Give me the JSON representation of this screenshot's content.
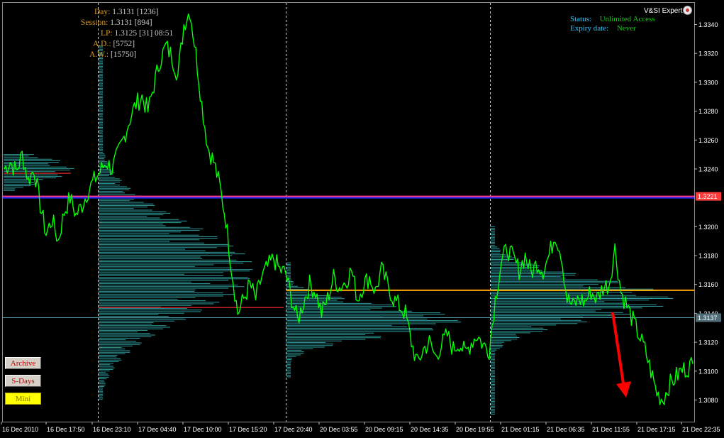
{
  "info": {
    "day_label": "Day:",
    "day_value": "1.3131  [1236]",
    "session_label": "Session:",
    "session_value": "1.3131  [894]",
    "lp_label": "LP:",
    "lp_value": "1.3125  [31]  08:51",
    "ad_label": "A.D.:",
    "ad_value": "[5752]",
    "aw_label": "A.W.:",
    "aw_value": "[15750]"
  },
  "status": {
    "status_label": "Status:",
    "status_value": "Unlimited Access",
    "expiry_label": "Expiry date:",
    "expiry_value": "Never"
  },
  "expert": {
    "name": "V&SI Expert"
  },
  "buttons": {
    "archive": "Archive",
    "sdays": "S-Days",
    "mini": "Mini"
  },
  "colors": {
    "price": "#00ff00",
    "profile": "#2e9b9b",
    "session_line": "#ffa500",
    "price_line": "#ff3a8a",
    "blue_line": "#1e2aff",
    "arrow": "#ff0000",
    "label_price_bg": "#ff3a3a",
    "label_cyan_bg": "#506e78"
  },
  "chart_data": {
    "type": "line",
    "y_ticks": [
      "1.3340",
      "1.3320",
      "1.3300",
      "1.3280",
      "1.3260",
      "1.3240",
      "1.3200",
      "1.3180",
      "1.3160",
      "1.3140",
      "1.3120",
      "1.3100",
      "1.3080"
    ],
    "ylim": [
      1.3065,
      1.3355
    ],
    "x_ticks": [
      "16 Dec 2010",
      "16 Dec 17:50",
      "16 Dec 23:10",
      "17 Dec 04:40",
      "17 Dec 10:00",
      "17 Dec 15:20",
      "17 Dec 20:40",
      "20 Dec 03:55",
      "20 Dec 09:15",
      "20 Dec 14:35",
      "20 Dec 19:55",
      "21 Dec 01:15",
      "21 Dec 06:35",
      "21 Dec 11:55",
      "21 Dec 17:15",
      "21 Dec 22:35"
    ],
    "series": [
      {
        "values": [
          1.324,
          1.3245,
          1.3238,
          1.325,
          1.3232,
          1.324,
          1.3215,
          1.3195,
          1.3205,
          1.319,
          1.321,
          1.322,
          1.3208,
          1.3215,
          1.3225,
          1.3232,
          1.3238,
          1.3245,
          1.324,
          1.325,
          1.3262,
          1.3275,
          1.3285,
          1.329,
          1.328,
          1.3298,
          1.3315,
          1.3325,
          1.3318,
          1.3305,
          1.334,
          1.335,
          1.332,
          1.3285,
          1.3255,
          1.3245,
          1.3228,
          1.3205,
          1.317,
          1.314,
          1.315,
          1.316,
          1.315,
          1.3165,
          1.3172,
          1.3178,
          1.317,
          1.3168,
          1.315,
          1.3135,
          1.3148,
          1.316,
          1.3155,
          1.314,
          1.315,
          1.3165,
          1.3158,
          1.3162,
          1.317,
          1.315,
          1.316,
          1.3165,
          1.3155,
          1.317,
          1.316,
          1.315,
          1.3145,
          1.314,
          1.312,
          1.3105,
          1.3115,
          1.312,
          1.311,
          1.3118,
          1.3125,
          1.3115,
          1.312,
          1.3112,
          1.312,
          1.3125,
          1.3118,
          1.3115,
          1.315,
          1.3175,
          1.3185,
          1.3178,
          1.317,
          1.318,
          1.3168,
          1.3175,
          1.317,
          1.318,
          1.3195,
          1.3182,
          1.315,
          1.3145,
          1.315,
          1.3148,
          1.3155,
          1.315,
          1.3158,
          1.316,
          1.3185,
          1.3155,
          1.3145,
          1.3135,
          1.3125,
          1.3115,
          1.31,
          1.3085,
          1.308,
          1.309,
          1.3095,
          1.31,
          1.3102,
          1.3105
        ]
      }
    ],
    "h_lines": [
      {
        "value": 1.3221,
        "label": "1.3221"
      },
      {
        "value": 1.3137,
        "label": "1.3137"
      },
      {
        "value": 1.3156
      }
    ]
  }
}
